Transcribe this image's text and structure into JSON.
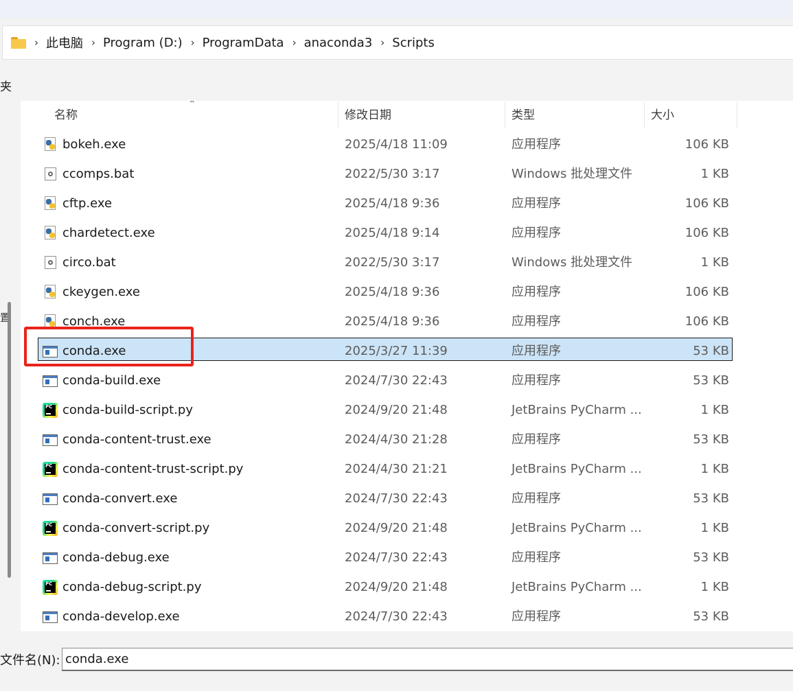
{
  "breadcrumb": [
    "此电脑",
    "Program (D:)",
    "ProgramData",
    "anaconda3",
    "Scripts"
  ],
  "toolbar_fragment": "夹",
  "sidebar_fragment": "置",
  "columns": {
    "name": "名称",
    "date": "修改日期",
    "type": "类型",
    "size": "大小"
  },
  "sort_indicator": "^",
  "files": [
    {
      "icon": "python-exe-icon",
      "name": "bokeh.exe",
      "date": "2025/4/18 11:09",
      "type": "应用程序",
      "size": "106 KB"
    },
    {
      "icon": "batch-file-icon",
      "name": "ccomps.bat",
      "date": "2022/5/30 3:17",
      "type": "Windows 批处理文件",
      "size": "1 KB"
    },
    {
      "icon": "python-exe-icon",
      "name": "cftp.exe",
      "date": "2025/4/18 9:36",
      "type": "应用程序",
      "size": "106 KB"
    },
    {
      "icon": "python-exe-icon",
      "name": "chardetect.exe",
      "date": "2025/4/18 9:14",
      "type": "应用程序",
      "size": "106 KB"
    },
    {
      "icon": "batch-file-icon",
      "name": "circo.bat",
      "date": "2022/5/30 3:17",
      "type": "Windows 批处理文件",
      "size": "1 KB"
    },
    {
      "icon": "python-exe-icon",
      "name": "ckeygen.exe",
      "date": "2025/4/18 9:36",
      "type": "应用程序",
      "size": "106 KB"
    },
    {
      "icon": "python-exe-icon",
      "name": "conch.exe",
      "date": "2025/4/18 9:36",
      "type": "应用程序",
      "size": "106 KB"
    },
    {
      "icon": "application-icon",
      "name": "conda.exe",
      "date": "2025/3/27 11:39",
      "type": "应用程序",
      "size": "53 KB",
      "selected": true
    },
    {
      "icon": "application-icon",
      "name": "conda-build.exe",
      "date": "2024/7/30 22:43",
      "type": "应用程序",
      "size": "53 KB"
    },
    {
      "icon": "pycharm-icon",
      "name": "conda-build-script.py",
      "date": "2024/9/20 21:48",
      "type": "JetBrains PyCharm ...",
      "size": "1 KB"
    },
    {
      "icon": "application-icon",
      "name": "conda-content-trust.exe",
      "date": "2024/4/30 21:28",
      "type": "应用程序",
      "size": "53 KB"
    },
    {
      "icon": "pycharm-icon",
      "name": "conda-content-trust-script.py",
      "date": "2024/4/30 21:21",
      "type": "JetBrains PyCharm ...",
      "size": "1 KB"
    },
    {
      "icon": "application-icon",
      "name": "conda-convert.exe",
      "date": "2024/7/30 22:43",
      "type": "应用程序",
      "size": "53 KB"
    },
    {
      "icon": "pycharm-icon",
      "name": "conda-convert-script.py",
      "date": "2024/9/20 21:48",
      "type": "JetBrains PyCharm ...",
      "size": "1 KB"
    },
    {
      "icon": "application-icon",
      "name": "conda-debug.exe",
      "date": "2024/7/30 22:43",
      "type": "应用程序",
      "size": "53 KB"
    },
    {
      "icon": "pycharm-icon",
      "name": "conda-debug-script.py",
      "date": "2024/9/20 21:48",
      "type": "JetBrains PyCharm ...",
      "size": "1 KB"
    },
    {
      "icon": "application-icon",
      "name": "conda-develop.exe",
      "date": "2024/7/30 22:43",
      "type": "应用程序",
      "size": "53 KB"
    }
  ],
  "filename": {
    "label": "文件名(N):",
    "value": "conda.exe"
  },
  "colors": {
    "selection": "#cce4f7",
    "annotation": "#e8231b",
    "folder": "#f8c84a"
  }
}
